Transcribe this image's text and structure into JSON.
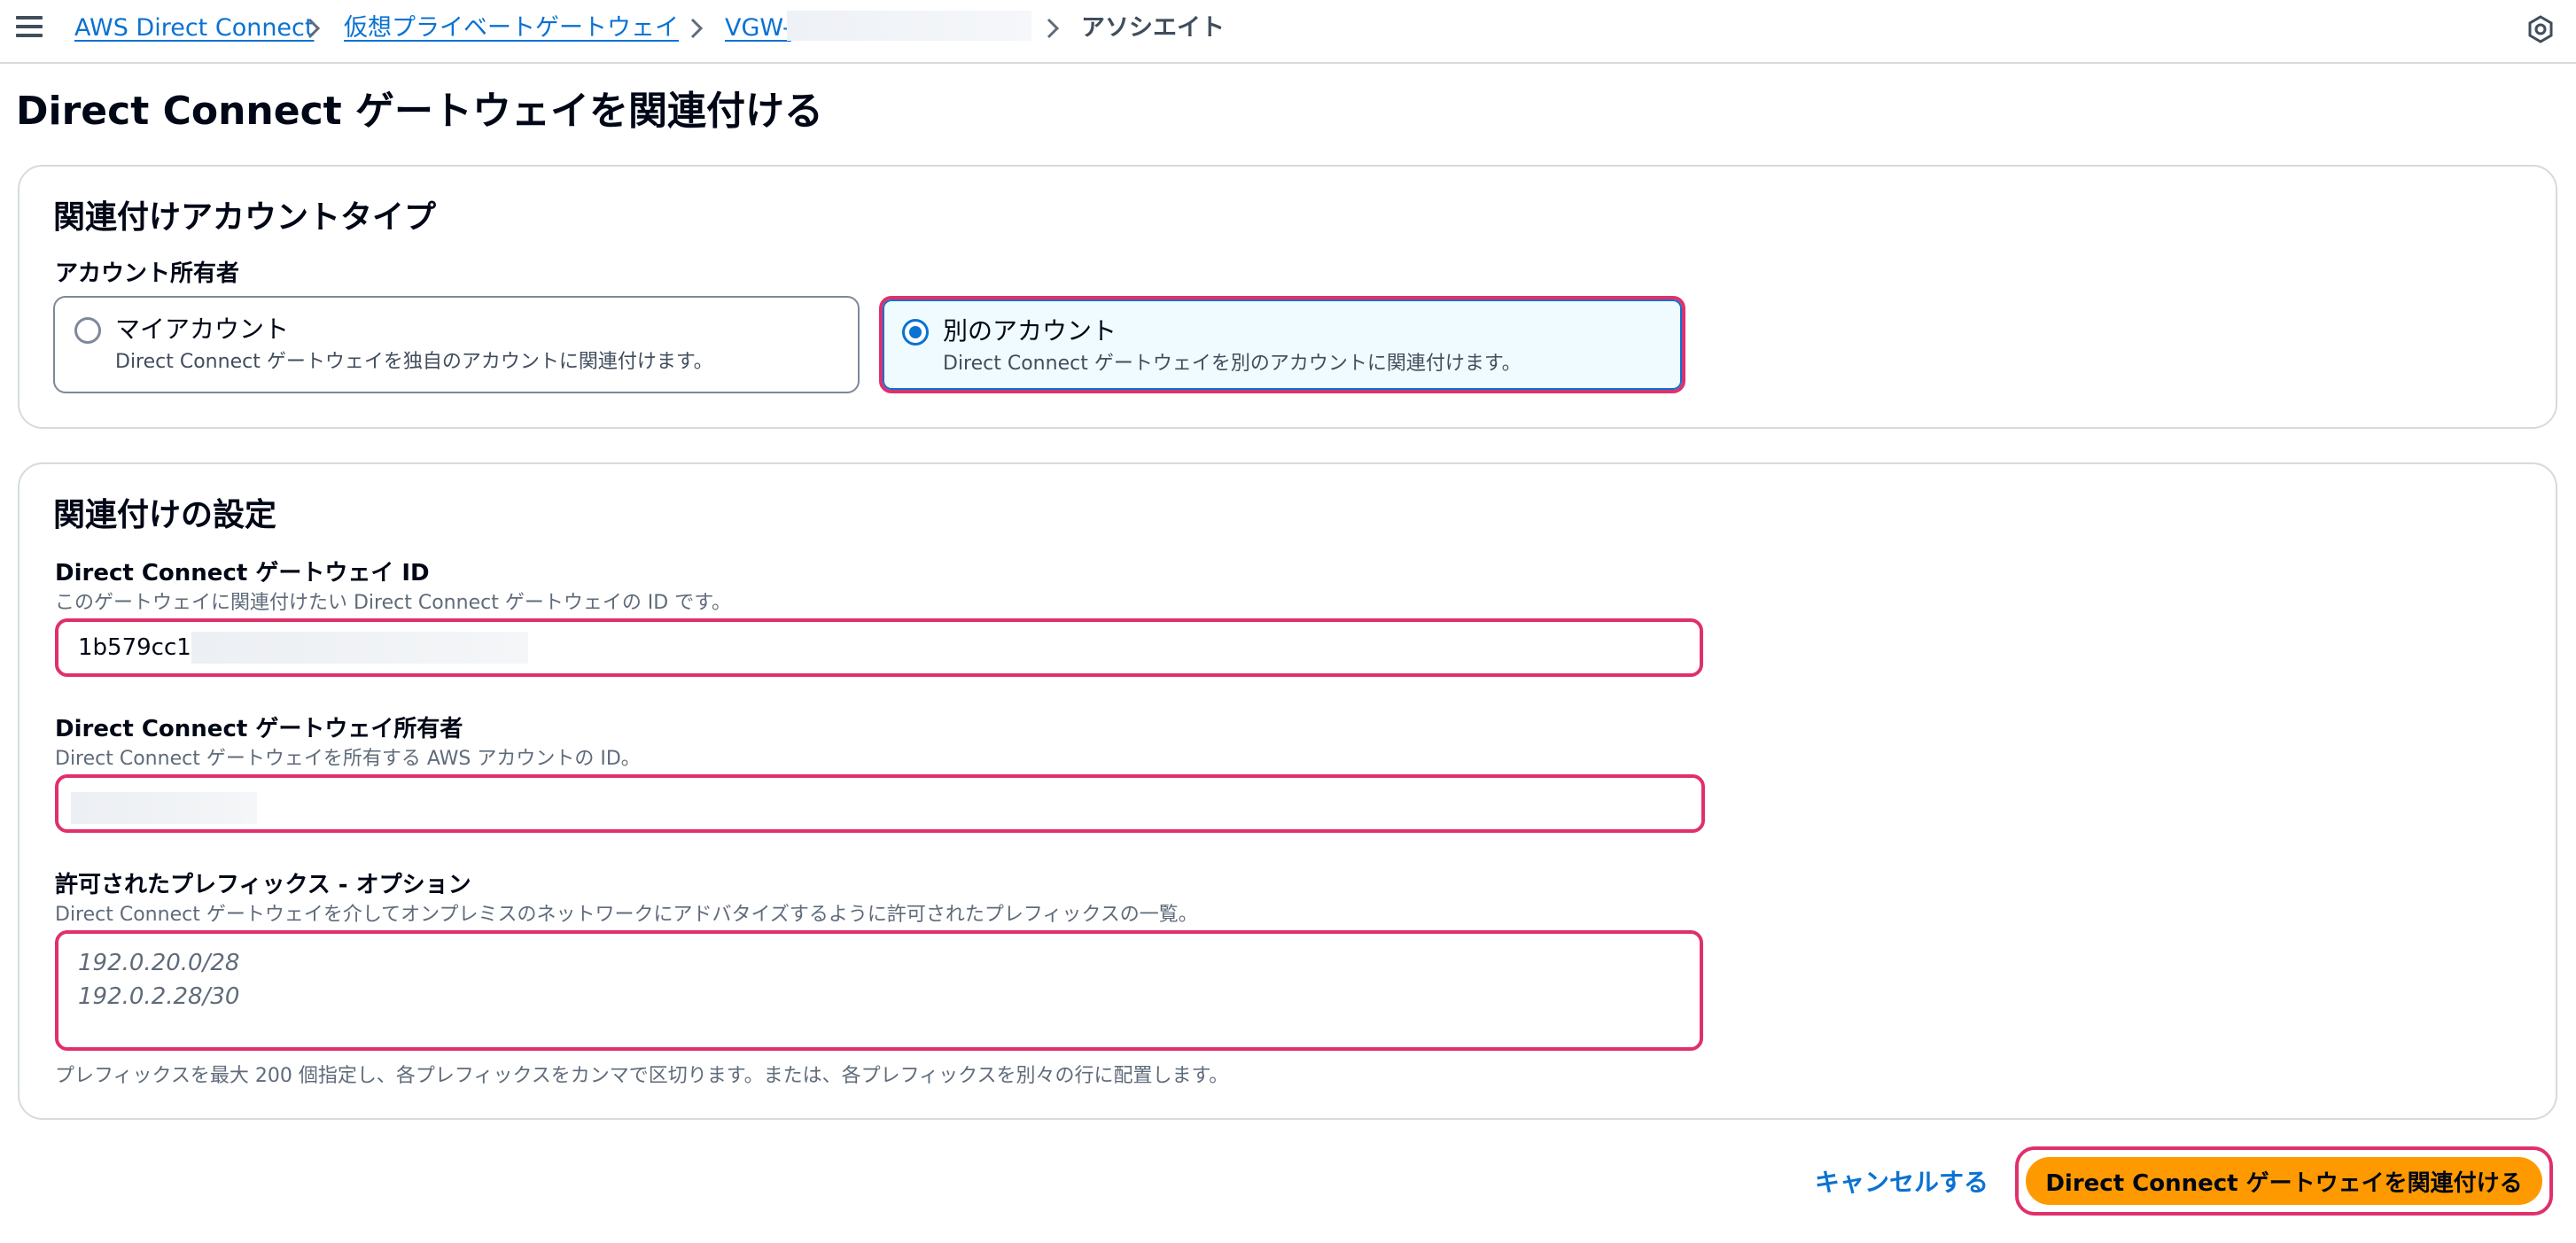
{
  "breadcrumb": {
    "items": [
      "AWS Direct Connect",
      "仮想プライベートゲートウェイ",
      "VGW-"
    ],
    "current": "アソシエイト"
  },
  "page_title": "Direct Connect ゲートウェイを関連付ける",
  "account_section": {
    "heading": "関連付けアカウントタイプ",
    "field_label": "アカウント所有者",
    "options": [
      {
        "title": "マイアカウント",
        "description": "Direct Connect ゲートウェイを独自のアカウントに関連付けます。",
        "selected": false
      },
      {
        "title": "別のアカウント",
        "description": "Direct Connect ゲートウェイを別のアカウントに関連付けます。",
        "selected": true
      }
    ]
  },
  "settings_section": {
    "heading": "関連付けの設定",
    "gateway_id": {
      "label": "Direct Connect ゲートウェイ ID",
      "description": "このゲートウェイに関連付けたい Direct Connect ゲートウェイの ID です。",
      "value": "1b579cc1-"
    },
    "gateway_owner": {
      "label": "Direct Connect ゲートウェイ所有者",
      "description": "Direct Connect ゲートウェイを所有する AWS アカウントの ID。",
      "value": ""
    },
    "prefixes": {
      "label": "許可されたプレフィックス - オプション",
      "description": "Direct Connect ゲートウェイを介してオンプレミスのネットワークにアドバタイズするように許可されたプレフィックスの一覧。",
      "placeholder": "192.0.20.0/28\n192.0.2.28/30",
      "hint": "プレフィックスを最大 200 個指定し、各プレフィックスをカンマで区切ります。または、各プレフィックスを別々の行に配置します。"
    }
  },
  "actions": {
    "cancel": "キャンセルする",
    "submit": "Direct Connect ゲートウェイを関連付ける"
  },
  "colors": {
    "link": "#0972d3",
    "primary": "#ff9900",
    "highlight": "#e0306b"
  }
}
